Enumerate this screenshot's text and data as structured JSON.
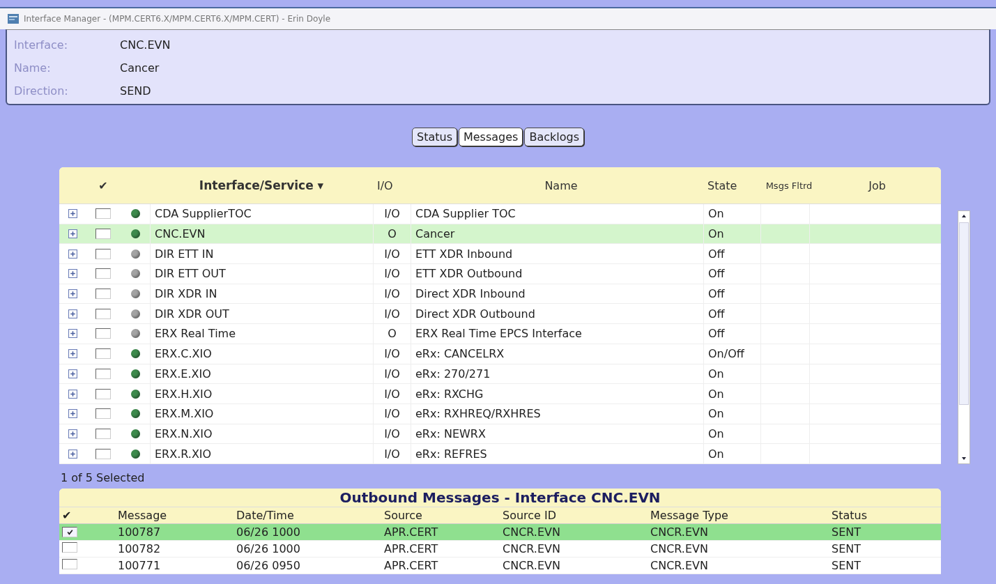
{
  "window": {
    "title": "Interface Manager - (MPM.CERT6.X/MPM.CERT6.X/MPM.CERT) - Erin Doyle"
  },
  "header": [
    {
      "label": "Interface:",
      "value": "CNC.EVN"
    },
    {
      "label": "Name:",
      "value": "Cancer"
    },
    {
      "label": "Direction:",
      "value": "SEND"
    }
  ],
  "tabs": [
    {
      "label": "Status",
      "selected": false
    },
    {
      "label": "Messages",
      "selected": true
    },
    {
      "label": "Backlogs",
      "selected": false
    }
  ],
  "interfaces": {
    "columns": [
      "✔",
      "Interface/Service ▾",
      "I/O",
      "Name",
      "State",
      "Msgs Fltrd",
      "Job"
    ],
    "rows": [
      {
        "interface": "CDA SupplierTOC",
        "io": "I/O",
        "name": "CDA Supplier TOC",
        "state": "On",
        "color": "#3d8a4c",
        "checked": false,
        "selected": false
      },
      {
        "interface": "CNC.EVN",
        "io": "O",
        "name": "Cancer",
        "state": "On",
        "color": "#3d8a4c",
        "checked": false,
        "selected": true
      },
      {
        "interface": "DIR ETT IN",
        "io": "I/O",
        "name": "ETT XDR Inbound",
        "state": "Off",
        "color": "#a3a3a3",
        "checked": false,
        "selected": false
      },
      {
        "interface": "DIR ETT OUT",
        "io": "I/O",
        "name": "ETT XDR Outbound",
        "state": "Off",
        "color": "#a3a3a3",
        "checked": false,
        "selected": false
      },
      {
        "interface": "DIR XDR IN",
        "io": "I/O",
        "name": "Direct XDR Inbound",
        "state": "Off",
        "color": "#a3a3a3",
        "checked": false,
        "selected": false
      },
      {
        "interface": "DIR XDR OUT",
        "io": "I/O",
        "name": "Direct XDR Outbound",
        "state": "Off",
        "color": "#a3a3a3",
        "checked": false,
        "selected": false
      },
      {
        "interface": "ERX Real Time",
        "io": "O",
        "name": "ERX Real Time EPCS Interface",
        "state": "Off",
        "color": "#a3a3a3",
        "checked": false,
        "selected": false
      },
      {
        "interface": "ERX.C.XIO",
        "io": "I/O",
        "name": "eRx: CANCELRX",
        "state": "On/Off",
        "color": "#3d8a4c",
        "checked": false,
        "selected": false
      },
      {
        "interface": "ERX.E.XIO",
        "io": "I/O",
        "name": "eRx: 270/271",
        "state": "On",
        "color": "#3d8a4c",
        "checked": false,
        "selected": false
      },
      {
        "interface": "ERX.H.XIO",
        "io": "I/O",
        "name": "eRx: RXCHG",
        "state": "On",
        "color": "#3d8a4c",
        "checked": false,
        "selected": false
      },
      {
        "interface": "ERX.M.XIO",
        "io": "I/O",
        "name": "eRx: RXHREQ/RXHRES",
        "state": "On",
        "color": "#3d8a4c",
        "checked": false,
        "selected": false
      },
      {
        "interface": "ERX.N.XIO",
        "io": "I/O",
        "name": "eRx: NEWRX",
        "state": "On",
        "color": "#3d8a4c",
        "checked": false,
        "selected": false
      },
      {
        "interface": "ERX.R.XIO",
        "io": "I/O",
        "name": "eRx: REFRES",
        "state": "On",
        "color": "#3d8a4c",
        "checked": false,
        "selected": false
      }
    ]
  },
  "selection_count": "1 of 5 Selected",
  "messages": {
    "title": "Outbound Messages - Interface CNC.EVN",
    "columns": [
      "✔",
      "Message",
      "Date/Time",
      "Source",
      "Source ID",
      "Message Type",
      "Status"
    ],
    "rows": [
      {
        "message": "100787",
        "datetime": "06/26 1000",
        "source": "APR.CERT",
        "source_id": "CNCR.EVN",
        "type": "CNCR.EVN",
        "status": "SENT",
        "checked": true,
        "selected": true
      },
      {
        "message": "100782",
        "datetime": "06/26 1000",
        "source": "APR.CERT",
        "source_id": "CNCR.EVN",
        "type": "CNCR.EVN",
        "status": "SENT",
        "checked": false,
        "selected": false
      },
      {
        "message": "100771",
        "datetime": "06/26 0950",
        "source": "APR.CERT",
        "source_id": "CNCR.EVN",
        "type": "CNCR.EVN",
        "status": "SENT",
        "checked": false,
        "selected": false
      }
    ]
  }
}
